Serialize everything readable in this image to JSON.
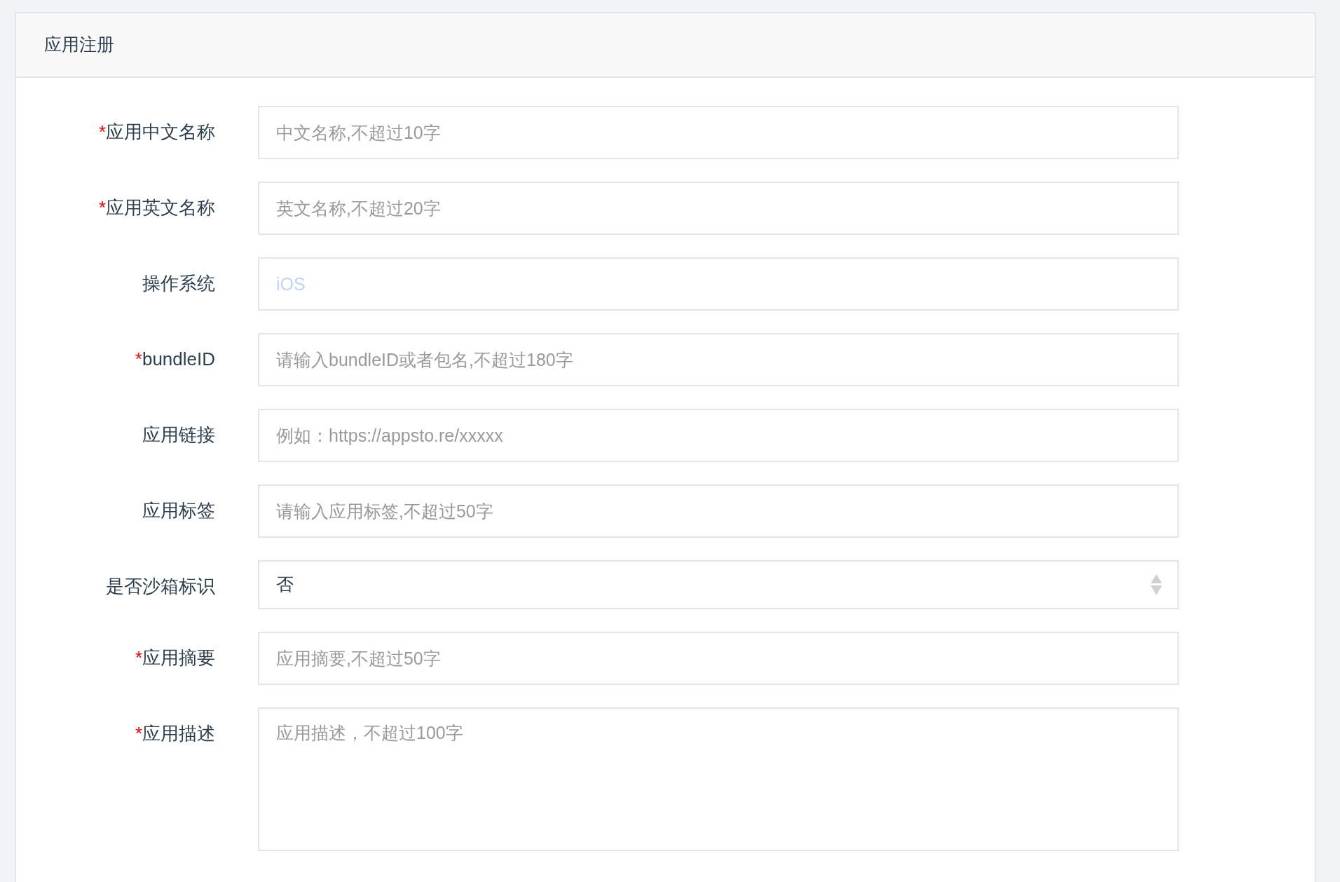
{
  "panel": {
    "title": "应用注册"
  },
  "fields": [
    {
      "kind": "input",
      "required_mark": "*",
      "label": "应用中文名称",
      "placeholder": "中文名称,不超过10字"
    },
    {
      "kind": "input",
      "required_mark": "*",
      "label": "应用英文名称",
      "placeholder": "英文名称,不超过20字"
    },
    {
      "kind": "input",
      "label": "操作系统",
      "value": "iOS",
      "disabled": true
    },
    {
      "kind": "input",
      "required_mark": "*",
      "label": "bundleID",
      "placeholder": "请输入bundleID或者包名,不超过180字"
    },
    {
      "kind": "input",
      "label": "应用链接",
      "placeholder": "例如：https://appsto.re/xxxxx"
    },
    {
      "kind": "input",
      "label": "应用标签",
      "placeholder": "请输入应用标签,不超过50字"
    },
    {
      "kind": "select",
      "label": "是否沙箱标识",
      "value": "否"
    },
    {
      "kind": "input",
      "required_mark": "*",
      "label": "应用摘要",
      "placeholder": "应用摘要,不超过50字"
    },
    {
      "kind": "textarea",
      "required_mark": "*",
      "label": "应用描述",
      "placeholder": "应用描述，不超过100字"
    }
  ]
}
